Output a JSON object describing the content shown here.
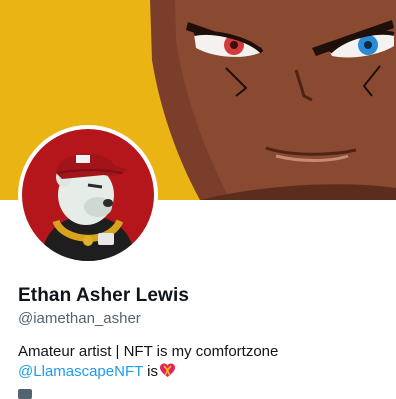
{
  "profile": {
    "display_name": "Ethan Asher Lewis",
    "handle": "@iamethan_asher",
    "bio_text": "Amateur artist | NFT is my comfortzone",
    "bio_mention": "@LlamascapeNFT",
    "bio_suffix": " is"
  },
  "icons": {
    "bio_emoji": "heart-with-ribbon-icon",
    "bottom": "calendar-icon"
  },
  "colors": {
    "banner_bg": "#eab414",
    "avatar_bg": "#b5161c",
    "mention": "#1d9bf0",
    "secondary_text": "#536471"
  }
}
